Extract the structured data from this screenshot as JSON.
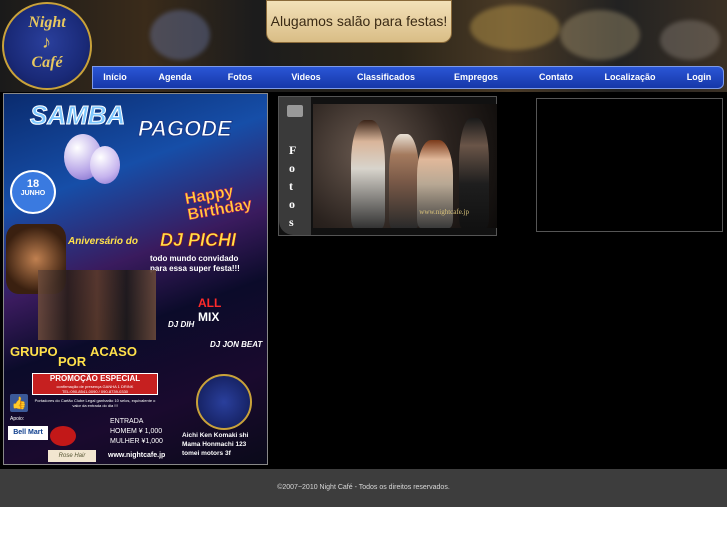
{
  "logo": {
    "line1": "Night",
    "line2": "Café",
    "icon": "saxophone-icon"
  },
  "banner": {
    "text": "Alugamos salão para festas!"
  },
  "nav": {
    "items": [
      "Início",
      "Agenda",
      "Fotos",
      "Videos",
      "Classificados",
      "Empregos",
      "Contato",
      "Localização",
      "Login"
    ]
  },
  "poster": {
    "title1": "SAMBA",
    "title2": "PAGODE",
    "date_day": "18",
    "date_month": "JUNHO",
    "happy": "Happy Birthday",
    "anniversary": "Aniversário do",
    "dj_name": "DJ PICHI",
    "invite1": "todo mundo convidado",
    "invite2": "para essa super festa!!!",
    "allmix1": "ALL",
    "allmix2": "MIX",
    "dj_dih": "DJ DIH",
    "dj_jon": "DJ JON BEAT",
    "group1": "GRUPO",
    "group2": "POR",
    "group3": "ACASO",
    "promo_title": "PROMOÇÃO ESPECIAL",
    "promo_line1": "confirmação de presença GANHA 1 DRINK",
    "promo_tel": "TEL:090-8541-0090 / 090-8739-0330",
    "card_note": "Portadores do Cartão Clube Legal ganharão 10 selos, equivalente o valor da entrada do dia !!!",
    "apoio": "Apoio:",
    "sponsor1": "Bell Mart",
    "sponsor2": "Rose Hair",
    "entrada": "ENTRADA",
    "homem": "HOMEM ¥ 1,000",
    "mulher": "MULHER ¥1,000",
    "address1": "Aichi Ken Komaki shi",
    "address2": "Mama Honmachi 123",
    "address3": "tomei motors 3f",
    "website": "www.nightcafe.jp"
  },
  "photos": {
    "tab_label": "Fotos",
    "letters": [
      "F",
      "o",
      "t",
      "o",
      "s"
    ],
    "watermark": "www.nightcafe.jp"
  },
  "footer": {
    "text": "©2007~2010 Night Café - Todos os direitos reservados."
  }
}
